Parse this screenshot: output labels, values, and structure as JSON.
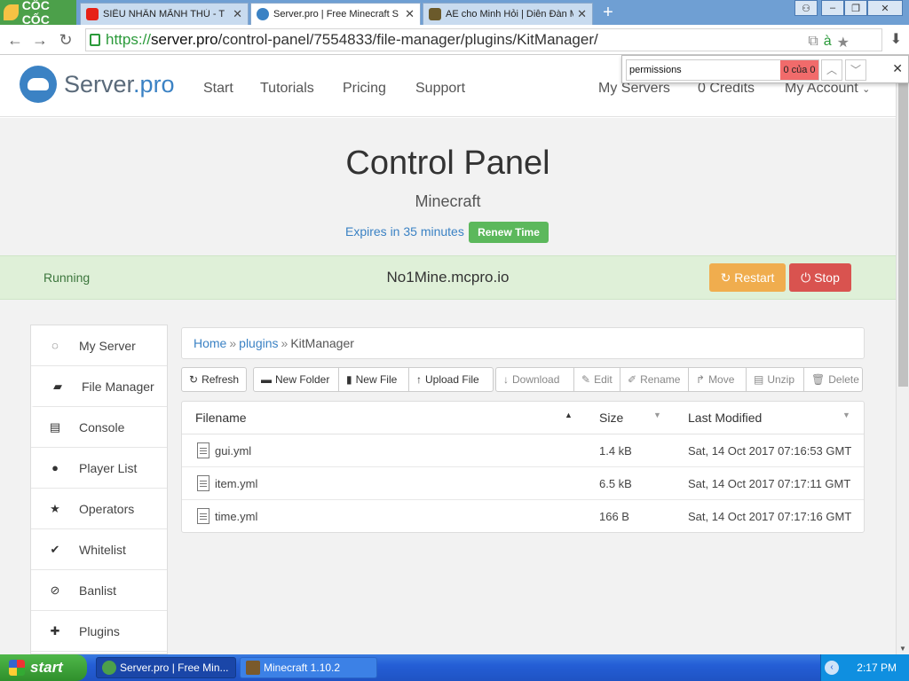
{
  "browser": {
    "brand": "CỐC CỐC",
    "tabs": [
      {
        "title": "SIÊU NHÂN MÃNH THÚ - T",
        "active": false
      },
      {
        "title": "Server.pro | Free Minecraft S",
        "active": true
      },
      {
        "title": "AE cho Minh Hỏi | Diễn Đàn M",
        "active": false
      }
    ],
    "url": {
      "scheme": "https://",
      "host": "server.pro",
      "path": "/control-panel/7554833/file-manager/plugins/KitManager/"
    },
    "find": {
      "query": "permissions",
      "count": "0 của 0"
    }
  },
  "header": {
    "logo": {
      "name": "Server",
      "suffix": ".pro"
    },
    "nav": [
      "Start",
      "Tutorials",
      "Pricing",
      "Support"
    ],
    "right_nav": [
      "My Servers",
      "0 Credits",
      "My Account"
    ]
  },
  "hero": {
    "title": "Control Panel",
    "subtitle": "Minecraft",
    "expiry": "Expires in 35 minutes",
    "renew_label": "Renew Time"
  },
  "status": {
    "state": "Running",
    "address": "No1Mine.mcpro.io",
    "restart_label": "Restart",
    "stop_label": "Stop"
  },
  "sidebar": {
    "items": [
      {
        "label": "My Server",
        "icon": "circle-notch-icon"
      },
      {
        "label": "File Manager",
        "icon": "folder-open-icon"
      },
      {
        "label": "Console",
        "icon": "terminal-icon"
      },
      {
        "label": "Player List",
        "icon": "user-icon"
      },
      {
        "label": "Operators",
        "icon": "star-icon"
      },
      {
        "label": "Whitelist",
        "icon": "check-icon"
      },
      {
        "label": "Banlist",
        "icon": "ban-icon"
      },
      {
        "label": "Plugins",
        "icon": "plus-icon"
      }
    ]
  },
  "breadcrumb": {
    "items": [
      "Home",
      "plugins",
      "KitManager"
    ]
  },
  "toolbar": {
    "refresh": "Refresh",
    "new_folder": "New Folder",
    "new_file": "New File",
    "upload_file": "Upload File",
    "download": "Download",
    "edit": "Edit",
    "rename": "Rename",
    "move": "Move",
    "unzip": "Unzip",
    "delete": "Delete"
  },
  "files": {
    "columns": [
      "Filename",
      "Size",
      "Last Modified"
    ],
    "rows": [
      {
        "name": "gui.yml",
        "size": "1.4 kB",
        "modified": "Sat, 14 Oct 2017 07:16:53 GMT"
      },
      {
        "name": "item.yml",
        "size": "6.5 kB",
        "modified": "Sat, 14 Oct 2017 07:17:11 GMT"
      },
      {
        "name": "time.yml",
        "size": "166 B",
        "modified": "Sat, 14 Oct 2017 07:17:16 GMT"
      }
    ]
  },
  "taskbar": {
    "start_label": "start",
    "items": [
      "Server.pro | Free Min...",
      "Minecraft 1.10.2"
    ],
    "clock": "2:17 PM"
  },
  "colors": {
    "accent": "#3b82c4",
    "success": "#5cb85c",
    "warning": "#f0ad4e",
    "danger": "#d9534f",
    "status_bg": "#dff0d8"
  }
}
